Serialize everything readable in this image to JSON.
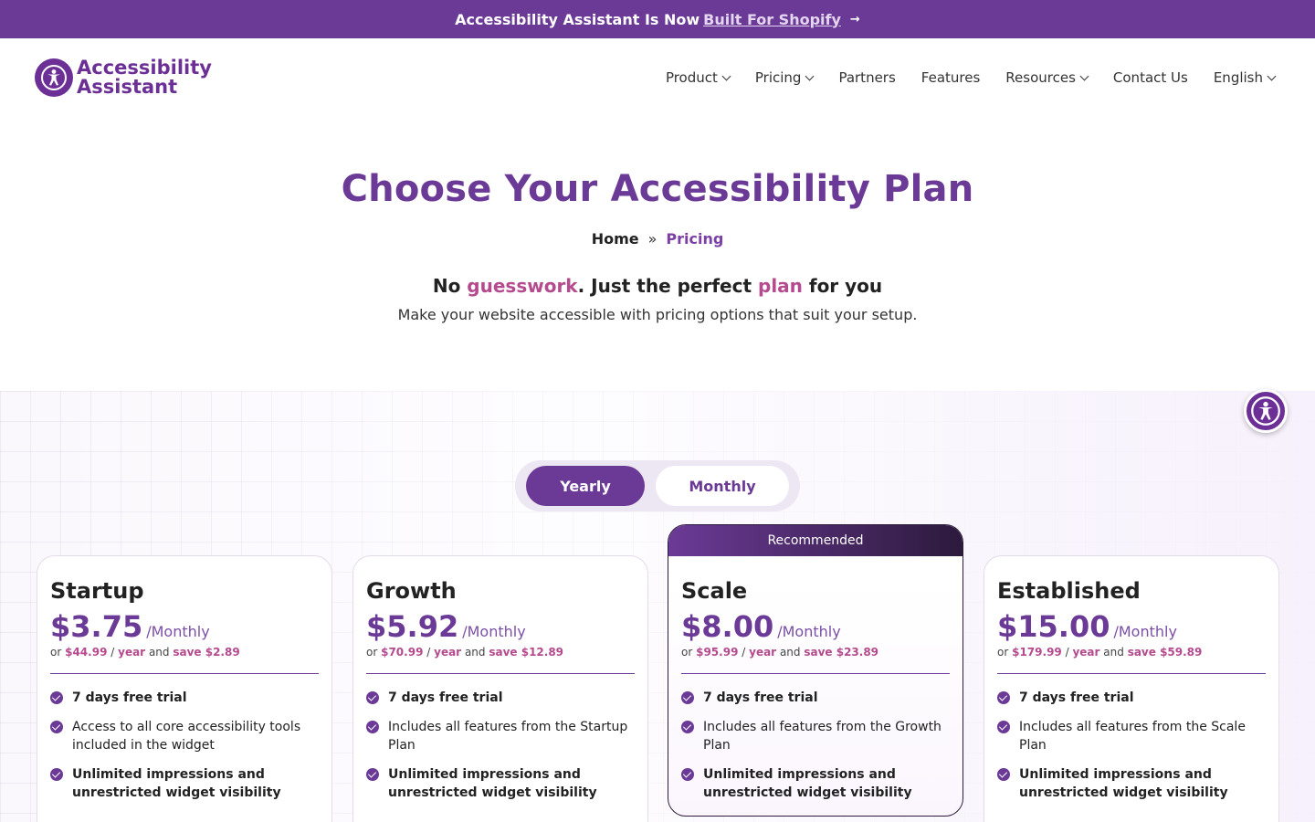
{
  "announcement": {
    "text": "Accessibility Assistant Is Now",
    "link": "Built For Shopify",
    "arrow": "→"
  },
  "header": {
    "logo_line1": "Accessibility",
    "logo_line2": "Assistant",
    "nav": [
      {
        "label": "Product"
      },
      {
        "label": "Pricing"
      },
      {
        "label": "Partners"
      },
      {
        "label": "Features"
      },
      {
        "label": "Resources"
      },
      {
        "label": "Contact Us"
      },
      {
        "label": "English"
      }
    ]
  },
  "hero": {
    "title": "Choose Your Accessibility Plan",
    "breadcrumb_home": "Home",
    "breadcrumb_sep": "»",
    "breadcrumb_current": "Pricing",
    "tag_1": "No ",
    "tag_hl1": "guesswork",
    "tag_2": ". Just the perfect ",
    "tag_hl2": "plan",
    "tag_3": " for you",
    "subtitle": "Make your website accessible with pricing options that suit your setup."
  },
  "toggle": {
    "yearly": "Yearly",
    "monthly": "Monthly",
    "selected": "Yearly"
  },
  "recommended_label": "Recommended",
  "plans": [
    {
      "name": "Startup",
      "price": "$3.75",
      "per": "/Monthly",
      "or": "or",
      "yearly_price": "$44.99",
      "slash": "/",
      "year": "year",
      "and": "and",
      "save": "save $2.89",
      "features": [
        "7 days free trial",
        "Access to all core accessibility tools included in the widget",
        "Unlimited impressions and unrestricted widget visibility"
      ]
    },
    {
      "name": "Growth",
      "price": "$5.92",
      "per": "/Monthly",
      "or": "or",
      "yearly_price": "$70.99",
      "slash": "/",
      "year": "year",
      "and": "and",
      "save": "save $12.89",
      "features": [
        "7 days free trial",
        "Includes all features from the Startup Plan",
        "Unlimited impressions and unrestricted widget visibility"
      ]
    },
    {
      "name": "Scale",
      "price": "$8.00",
      "per": "/Monthly",
      "or": "or",
      "yearly_price": "$95.99",
      "slash": "/",
      "year": "year",
      "and": "and",
      "save": "save $23.89",
      "features": [
        "7 days free trial",
        "Includes all features from the Growth Plan",
        "Unlimited impressions and unrestricted widget visibility"
      ]
    },
    {
      "name": "Established",
      "price": "$15.00",
      "per": "/Monthly",
      "or": "or",
      "yearly_price": "$179.99",
      "slash": "/",
      "year": "year",
      "and": "and",
      "save": "save $59.89",
      "features": [
        "7 days free trial",
        "Includes all features from the Scale Plan",
        "Unlimited impressions and unrestricted widget visibility"
      ]
    }
  ],
  "colors": {
    "brand": "#6b3a96",
    "accent": "#b54a8e"
  },
  "icons": {
    "logo": "accessibility-person-icon",
    "widget": "accessibility-person-icon",
    "check": "check-circle-icon",
    "chevron": "chevron-down-icon"
  }
}
